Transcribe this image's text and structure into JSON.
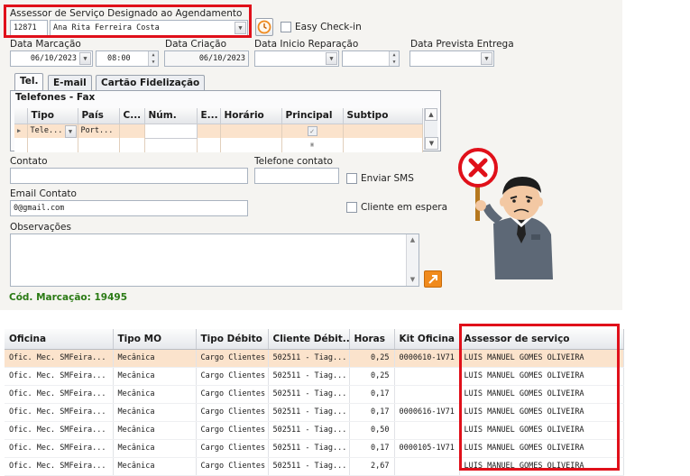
{
  "assessor": {
    "label": "Assessor de Serviço Designado ao Agendamento",
    "code": "12871",
    "name": "Ana Rita Ferreira Costa"
  },
  "easy_checkin": {
    "label": "Easy Check-in",
    "checked": false
  },
  "dates": {
    "marcacao": {
      "label": "Data Marcação",
      "date": "06/10/2023",
      "time": "08:00"
    },
    "criacao": {
      "label": "Data Criação",
      "date": "06/10/2023"
    },
    "inicio_reparacao": {
      "label": "Data Inicio Reparação",
      "date": ""
    },
    "prevista_entrega": {
      "label": "Data Prevista Entrega",
      "date": ""
    }
  },
  "tabs": [
    {
      "label": "Tel.",
      "active": true
    },
    {
      "label": "E-mail",
      "active": false
    },
    {
      "label": "Cartão Fidelização",
      "active": false
    }
  ],
  "phones": {
    "title": "Telefones - Fax",
    "columns": [
      "Tipo",
      "País",
      "C...",
      "Núm.",
      "E...",
      "Horário",
      "Principal",
      "Subtipo"
    ],
    "row": {
      "tipo": "Tele...",
      "pais": "Port...",
      "c": "",
      "num": "",
      "e": "",
      "horario": "",
      "principal": true,
      "subtipo": ""
    }
  },
  "contato": {
    "label": "Contato",
    "value": ""
  },
  "telefone_contato": {
    "label": "Telefone contato",
    "value": ""
  },
  "enviar_sms": {
    "label": "Enviar SMS",
    "checked": false
  },
  "email_contato": {
    "label": "Email Contato",
    "value": "0@gmail.com"
  },
  "cliente_espera": {
    "label": "Cliente em espera",
    "checked": false
  },
  "observacoes": {
    "label": "Observações",
    "value": ""
  },
  "cod_marcacao": {
    "text": "Cód. Marcação: 19495"
  },
  "grid": {
    "columns": [
      "Oficina",
      "Tipo MO",
      "Tipo Débito",
      "Cliente Débit...",
      "Horas",
      "Kit Oficina",
      "Assessor de serviço"
    ],
    "rows": [
      [
        "Ofic. Mec. SMFeira...",
        "Mecânica",
        "Cargo Clientes",
        "502511 - Tiag...",
        "0,25",
        "0000610-1V71",
        "LUIS MANUEL GOMES OLIVEIRA"
      ],
      [
        "Ofic. Mec. SMFeira...",
        "Mecânica",
        "Cargo Clientes",
        "502511 - Tiag...",
        "0,25",
        "",
        "LUIS MANUEL GOMES OLIVEIRA"
      ],
      [
        "Ofic. Mec. SMFeira...",
        "Mecânica",
        "Cargo Clientes",
        "502511 - Tiag...",
        "0,17",
        "",
        "LUIS MANUEL GOMES OLIVEIRA"
      ],
      [
        "Ofic. Mec. SMFeira...",
        "Mecânica",
        "Cargo Clientes",
        "502511 - Tiag...",
        "0,17",
        "0000616-1V71",
        "LUIS MANUEL GOMES OLIVEIRA"
      ],
      [
        "Ofic. Mec. SMFeira...",
        "Mecânica",
        "Cargo Clientes",
        "502511 - Tiag...",
        "0,50",
        "",
        "LUIS MANUEL GOMES OLIVEIRA"
      ],
      [
        "Ofic. Mec. SMFeira...",
        "Mecânica",
        "Cargo Clientes",
        "502511 - Tiag...",
        "0,17",
        "0000105-1V71",
        "LUIS MANUEL GOMES OLIVEIRA"
      ],
      [
        "Ofic. Mec. SMFeira...",
        "Mecânica",
        "Cargo Clientes",
        "502511 - Tiag...",
        "2,67",
        "",
        "LUIS MANUEL GOMES OLIVEIRA"
      ]
    ]
  },
  "icons": {
    "clock": "clock-icon",
    "expand": "arrow-expand-icon",
    "error_sign": "red-x-sign-icon"
  },
  "colors": {
    "highlight_red": "#e0101a",
    "selected_row": "#fbe3cc",
    "panel": "#f5f4f1",
    "accent_green": "#2a7a14",
    "orange": "#f08a1c"
  }
}
